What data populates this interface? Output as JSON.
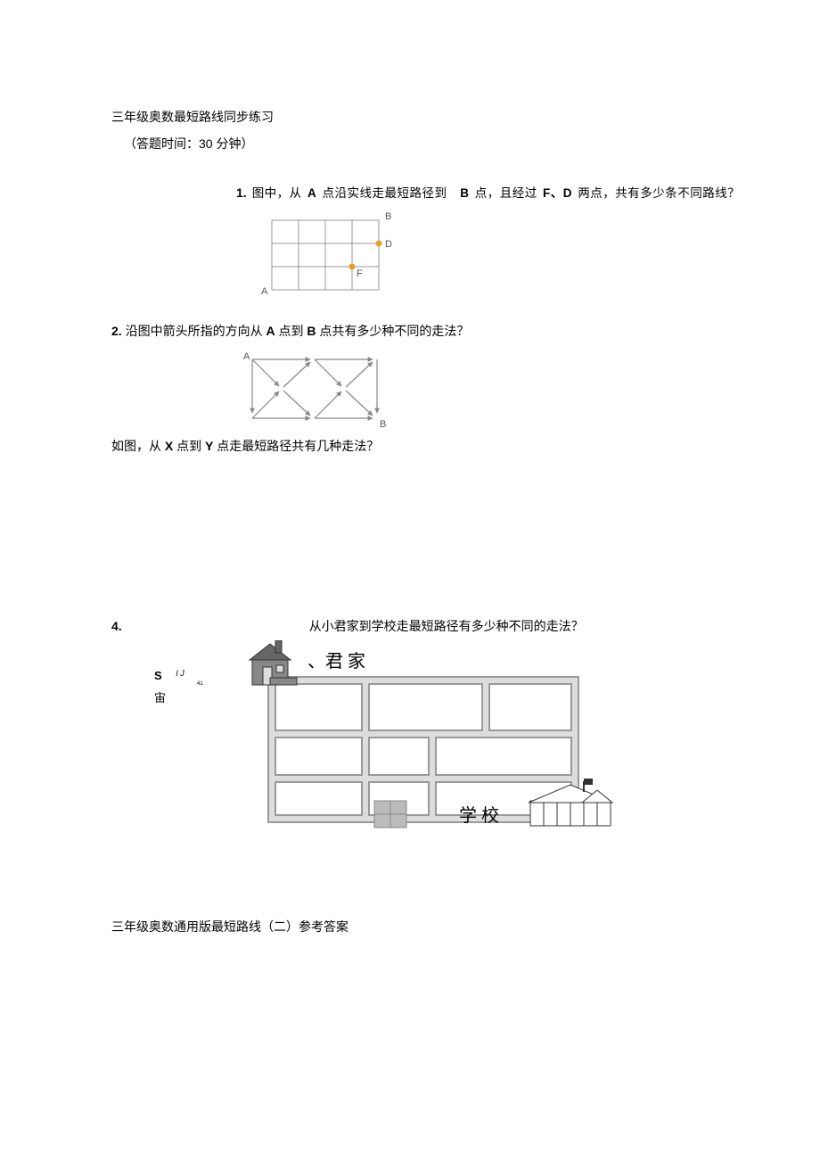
{
  "title": "三年级奥数最短路线同步练习",
  "subtitle": "（答题时间：30 分钟）",
  "q1": {
    "num": "1.",
    "t1": "图中，从",
    "a": "A",
    "t2": "点沿实线走最短路径到",
    "b": "B",
    "t3": "点，且经过",
    "f": "F、D",
    "t4": "两点，共有多少条不同路线？",
    "labelA": "A",
    "labelB": "B",
    "labelD": "D",
    "labelF": "F"
  },
  "q2": {
    "num": "2.",
    "t1": "沿图中箭头所指的方向从",
    "a": "A",
    "t2": "点到",
    "b": "B",
    "t3": "点共有多少种不同的走法？",
    "labelA": "A",
    "labelB": "B"
  },
  "q3": {
    "t1": "如图，从",
    "x": "X",
    "t2": "点到",
    "y": "Y",
    "t3": "点走最短路径共有几种走法？"
  },
  "q4": {
    "num": "4.",
    "text": "从小君家到学校走最短路径有多少种不同的走法？",
    "side1": "S",
    "side1b": "I J",
    "side1c": "41",
    "side2": "宙",
    "labelHome": "、君 家",
    "labelSchool": "学 校"
  },
  "footer": "三年级奥数通用版最短路线（二）参考答案"
}
